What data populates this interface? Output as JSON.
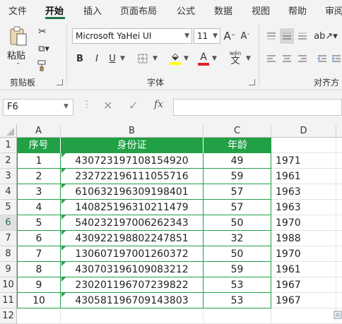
{
  "ribbon": {
    "tabs": [
      "文件",
      "开始",
      "插入",
      "页面布局",
      "公式",
      "数据",
      "视图",
      "帮助",
      "审阅"
    ],
    "groups": {
      "clipboard": {
        "label": "剪贴板",
        "paste_label": "粘贴"
      },
      "font": {
        "label": "字体",
        "font_name": "Microsoft YaHei UI",
        "font_size": "11",
        "wen_label": "wén",
        "bold": "B",
        "italic": "I",
        "underline": "U"
      },
      "alignment": {
        "label": "对齐方"
      }
    }
  },
  "formula_bar": {
    "name_box": "F6",
    "fx_label": "fx",
    "formula": ""
  },
  "columns": [
    "A",
    "B",
    "C",
    "D"
  ],
  "rows": [
    "1",
    "2",
    "3",
    "4",
    "5",
    "6",
    "7",
    "8",
    "9",
    "10",
    "11",
    "12"
  ],
  "selected_row": "6",
  "table": {
    "headers": [
      "序号",
      "身份证",
      "年龄"
    ],
    "rows": [
      {
        "no": "1",
        "id": "430723197108154920",
        "age": "49",
        "year": "1971"
      },
      {
        "no": "2",
        "id": "232722196111055716",
        "age": "59",
        "year": "1961"
      },
      {
        "no": "3",
        "id": "610632196309198401",
        "age": "57",
        "year": "1963"
      },
      {
        "no": "4",
        "id": "140825196310211479",
        "age": "57",
        "year": "1963"
      },
      {
        "no": "5",
        "id": "540232197006262343",
        "age": "50",
        "year": "1970"
      },
      {
        "no": "6",
        "id": "430922198802247851",
        "age": "32",
        "year": "1988"
      },
      {
        "no": "7",
        "id": "130607197001260372",
        "age": "50",
        "year": "1970"
      },
      {
        "no": "8",
        "id": "430703196109083212",
        "age": "59",
        "year": "1961"
      },
      {
        "no": "9",
        "id": "230201196707239822",
        "age": "53",
        "year": "1967"
      },
      {
        "no": "10",
        "id": "430581196709143803",
        "age": "53",
        "year": "1967"
      }
    ]
  },
  "colors": {
    "accent": "#217346",
    "table_green": "#21a046",
    "error_triangle": "#2e9b4b"
  }
}
